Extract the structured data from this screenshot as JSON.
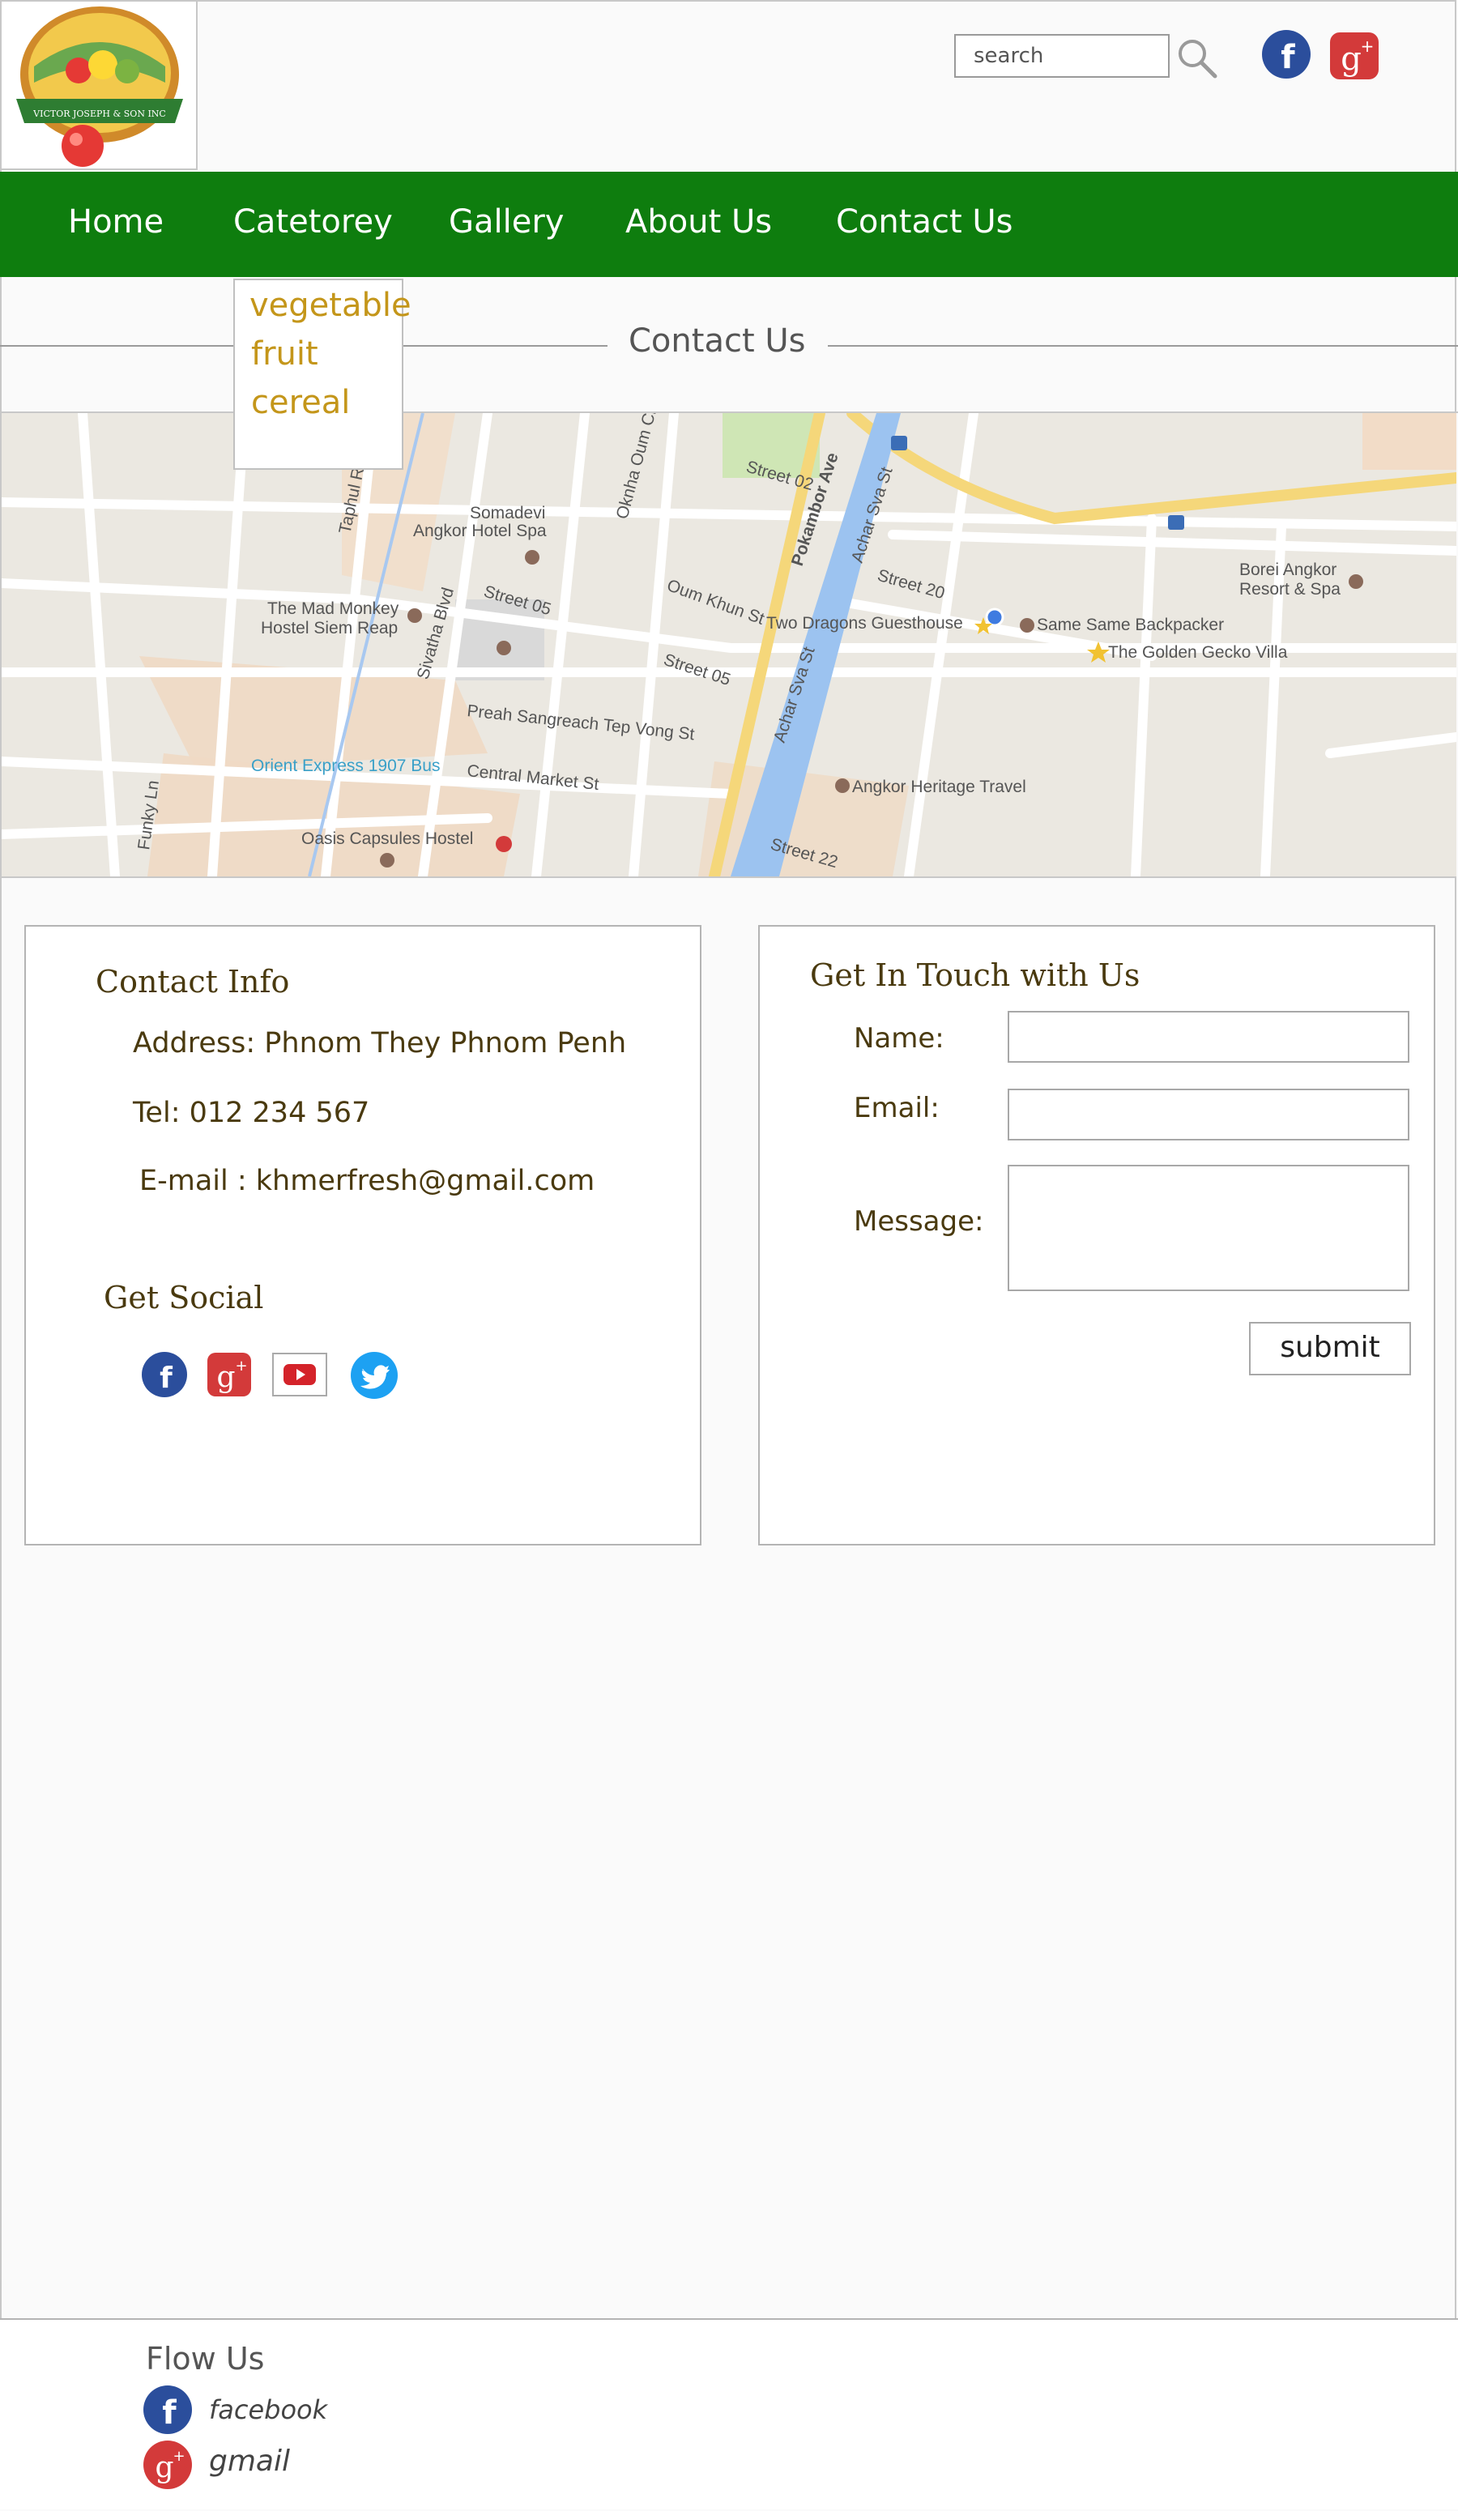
{
  "header": {
    "logo_text": "VICTOR JOSEPH & SON INC",
    "search": {
      "placeholder": "search"
    },
    "social": [
      "facebook-icon",
      "google-plus-icon"
    ]
  },
  "nav": {
    "items": [
      {
        "label": "Home"
      },
      {
        "label": "Catetorey"
      },
      {
        "label": "Gallery"
      },
      {
        "label": "About Us"
      },
      {
        "label": "Contact Us"
      }
    ]
  },
  "dropdown": {
    "items": [
      "vegetable",
      "fruit",
      "cereal"
    ]
  },
  "page": {
    "title": "Contact Us"
  },
  "map": {
    "labels": [
      "Taphul Rd",
      "Somadevi",
      "Angkor Hotel Spa",
      "Oknha Oum Chhay",
      "Street 02",
      "Pokambor Ave",
      "Achar Sva St",
      "Street 20",
      "Borei Angkor",
      "Resort & Spa",
      "The Mad Monkey",
      "Hostel Siem Reap",
      "Sivatha Blvd",
      "Street 05",
      "Oum Khun St",
      "Two Dragons Guesthouse",
      "Same Same Backpacker",
      "The Golden Gecko Villa",
      "Street 05",
      "Preah Sangreach Tep Vong St",
      "Achar Sva St",
      "Orient Express 1907 Bus",
      "Central Market St",
      "Angkor Heritage Travel",
      "Funky Ln",
      "Oasis Capsules Hostel",
      "Street 22"
    ]
  },
  "contact": {
    "heading": "Contact Info",
    "address": "Address: Phnom They Phnom Penh",
    "tel": "Tel: 012 234 567",
    "email": "E-mail : khmerfresh@gmail.com",
    "social_heading": "Get Social",
    "social": [
      "facebook-icon",
      "google-plus-icon",
      "youtube-icon",
      "twitter-icon"
    ]
  },
  "form": {
    "heading": "Get In Touch with Us",
    "name_label": "Name:",
    "email_label": "Email:",
    "message_label": "Message:",
    "name_value": "",
    "email_value": "",
    "message_value": "",
    "submit_label": "submit"
  },
  "footer": {
    "title": "Flow Us",
    "links": [
      {
        "label": "facebook",
        "icon": "facebook-icon"
      },
      {
        "label": "gmail",
        "icon": "google-plus-icon"
      }
    ]
  },
  "colors": {
    "nav_bg": "#0e7d0e",
    "dropdown_text": "#c4961a",
    "heading_text": "#4a3a0f",
    "facebook": "#2b4e9c",
    "google": "#d33a3a",
    "twitter": "#1da1f2",
    "youtube": "#d4232a"
  }
}
